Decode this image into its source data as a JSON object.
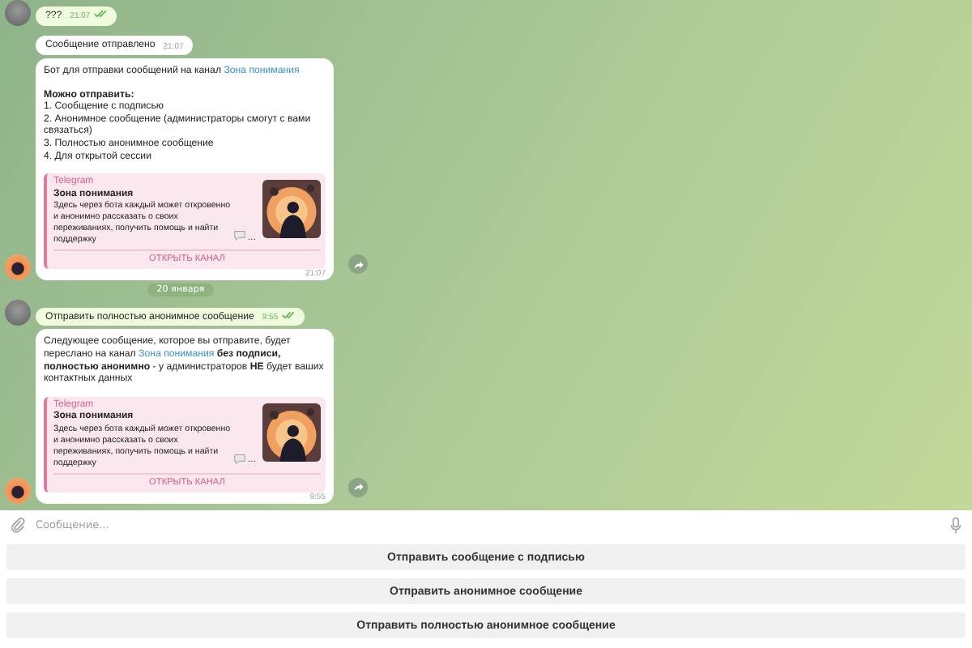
{
  "messages": [
    {
      "kind": "outgoing",
      "avatar": true,
      "text": "???",
      "time": "21:07",
      "read": true
    },
    {
      "kind": "incoming",
      "avatar": false,
      "text": "Сообщение отправлено",
      "time": "21:07"
    },
    {
      "kind": "rich",
      "avatar": true,
      "time": "21:07",
      "forward": true,
      "paragraphs": [
        [
          [
            {
              "kind": "plain",
              "text": "Бот для отправки сообщений на канал "
            },
            {
              "kind": "link",
              "text": "Зона понимания"
            }
          ]
        ],
        [
          [
            {
              "kind": "bold",
              "text": "Можно отправить:"
            }
          ],
          [
            {
              "kind": "plain",
              "text": "1. Сообщение с подписью"
            }
          ],
          [
            {
              "kind": "plain",
              "text": "2. Анонимное сообщение (администраторы смогут с вами связаться)"
            }
          ],
          [
            {
              "kind": "plain",
              "text": "3. Полностью анонимное сообщение"
            }
          ],
          [
            {
              "kind": "plain",
              "text": "4. Для открытой сессии"
            }
          ]
        ]
      ],
      "preview": {
        "site": "Telegram",
        "title": "Зона понимания",
        "description": "Здесь через бота каждый может откровенно и анонимно рассказать о своих переживаниях, получить помощь и найти поддержку",
        "tail": "…",
        "button": "ОТКРЫТЬ КАНАЛ"
      }
    },
    {
      "kind": "date",
      "text": "20 января"
    },
    {
      "kind": "outgoing",
      "avatar": true,
      "text": "Отправить полностью анонимное сообщение",
      "time": "9:55",
      "read": true
    },
    {
      "kind": "rich",
      "avatar": true,
      "time": "9:55",
      "forward": true,
      "paragraphs": [
        [
          [
            {
              "kind": "plain",
              "text": "Следующее сообщение, которое вы отправите, будет переслано на канал "
            },
            {
              "kind": "link",
              "text": "Зона понимания"
            },
            {
              "kind": "bold",
              "text": " без подписи, полностью анонимно"
            },
            {
              "kind": "plain",
              "text": " - у администраторов "
            },
            {
              "kind": "bold",
              "text": "НЕ"
            },
            {
              "kind": "plain",
              "text": " будет ваших контактных данных"
            }
          ]
        ]
      ],
      "preview": {
        "site": "Telegram",
        "title": "Зона понимания",
        "description": "Здесь через бота каждый может откровенно и анонимно рассказать о своих переживаниях, получить помощь и найти поддержку",
        "tail": "…",
        "button": "ОТКРЫТЬ КАНАЛ"
      }
    }
  ],
  "composer": {
    "placeholder": "Сообщение..."
  },
  "keyboard": [
    "Отправить сообщение с подписью",
    "Отправить анонимное сообщение",
    "Отправить полностью анонимное сообщение"
  ]
}
